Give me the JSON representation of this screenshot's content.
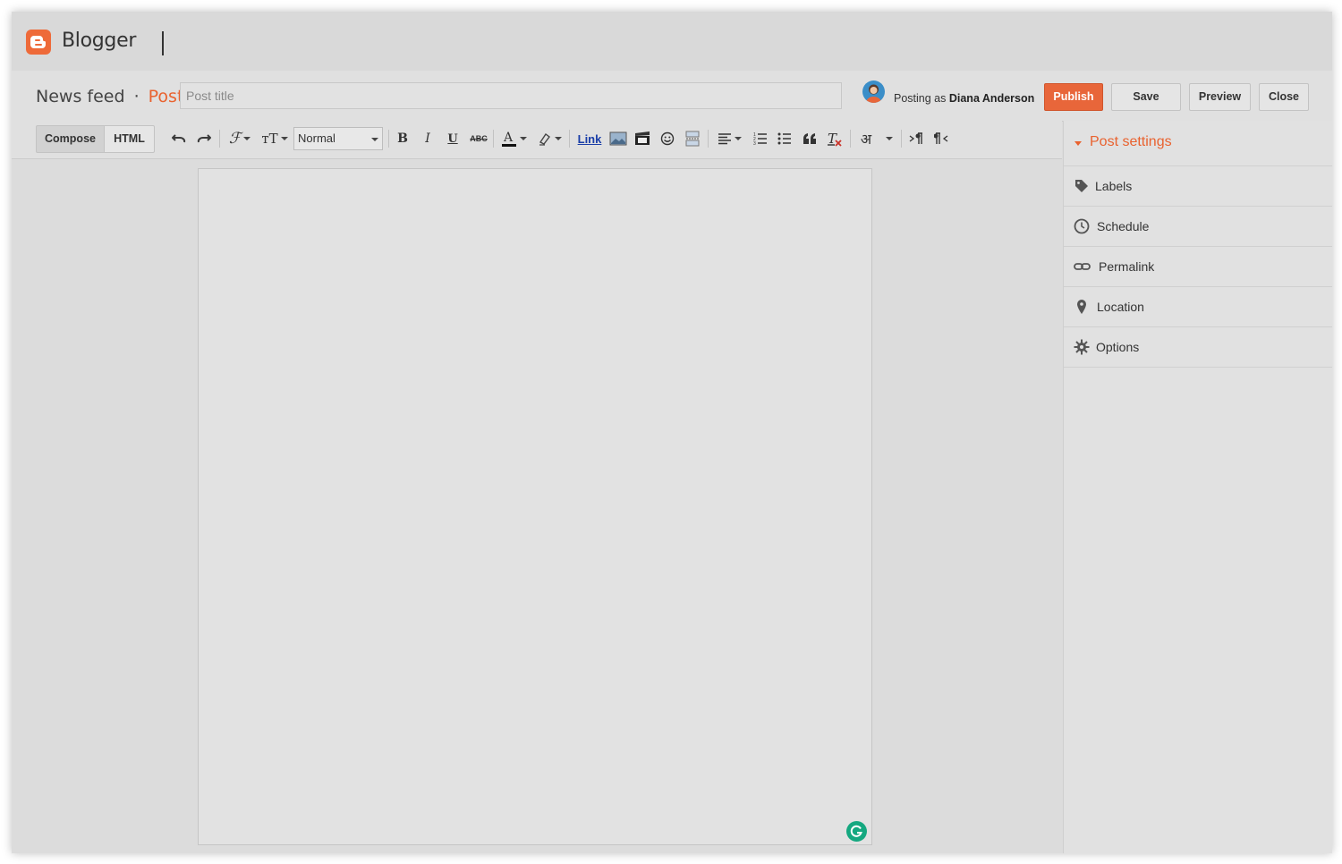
{
  "app": {
    "name": "Blogger",
    "accent": "#e9622f"
  },
  "header": {
    "blog_name": "News feed",
    "separator": "·",
    "section": "Post",
    "title_placeholder": "Post title",
    "posting_prefix": "Posting as",
    "user_name": "Diana Anderson"
  },
  "actions": {
    "publish": "Publish",
    "save": "Save",
    "preview": "Preview",
    "close": "Close"
  },
  "toolbar": {
    "compose": "Compose",
    "html": "HTML",
    "format_value": "Normal",
    "link": "Link",
    "lang_glyph": "अ",
    "icons": [
      "undo-icon",
      "redo-icon",
      "font-icon",
      "font-size-icon",
      "bold-icon",
      "italic-icon",
      "underline-icon",
      "strikethrough-icon",
      "text-color-icon",
      "highlight-icon",
      "image-icon",
      "video-icon",
      "emoji-icon",
      "jump-break-icon",
      "align-icon",
      "numbered-list-icon",
      "bulleted-list-icon",
      "quote-icon",
      "remove-format-icon",
      "ltr-icon",
      "rtl-icon"
    ]
  },
  "sidebar": {
    "title": "Post settings",
    "items": [
      {
        "label": "Labels",
        "icon": "tag-icon"
      },
      {
        "label": "Schedule",
        "icon": "clock-icon"
      },
      {
        "label": "Permalink",
        "icon": "link-icon"
      },
      {
        "label": "Location",
        "icon": "pin-icon"
      },
      {
        "label": "Options",
        "icon": "gear-icon"
      }
    ]
  }
}
